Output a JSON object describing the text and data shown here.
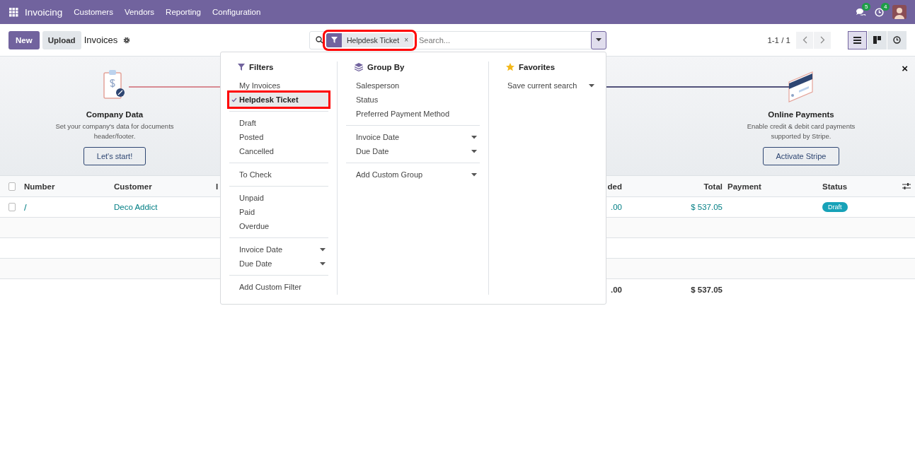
{
  "navbar": {
    "app": "Invoicing",
    "menus": [
      "Customers",
      "Vendors",
      "Reporting",
      "Configuration"
    ],
    "messages_badge": "5",
    "activities_badge": "4"
  },
  "control_panel": {
    "new_button": "New",
    "upload_button": "Upload",
    "title": "Invoices",
    "facet": {
      "label": "Helpdesk Ticket",
      "remove": "×",
      "highlighted": true
    },
    "search_placeholder": "Search...",
    "pager": "1-1 / 1",
    "views": [
      {
        "kind": "list",
        "selected": true
      },
      {
        "kind": "kanban",
        "selected": false
      },
      {
        "kind": "activity",
        "selected": false
      }
    ]
  },
  "onboarding": {
    "close": "×",
    "steps": [
      {
        "kind": "company",
        "title": "Company Data",
        "description": "Set your company's data for documents header/footer.",
        "button": "Let's start!"
      },
      {
        "kind": "payments",
        "title": "Online Payments",
        "description": "Enable credit & debit card payments supported by Stripe.",
        "button": "Activate Stripe"
      }
    ]
  },
  "table": {
    "all_selected": false,
    "columns": [
      "Number",
      "Customer",
      "I",
      "ded",
      "Total",
      "Payment",
      "Status"
    ],
    "rows": [
      {
        "number": "/",
        "customer": "Deco Addict",
        "column_4": ".00",
        "total": "$ 537.05",
        "status": "Draft",
        "selected": false
      }
    ],
    "totals": {
      "column_4": ".00",
      "total": "$ 537.05"
    }
  },
  "search_panel": {
    "filters": {
      "title": "Filters",
      "groups": [
        [
          {
            "label": "My Invoices",
            "kind": "option",
            "selected": false,
            "highlighted": false
          },
          {
            "label": "Helpdesk Ticket",
            "kind": "option",
            "selected": true,
            "highlighted": true
          }
        ],
        [
          {
            "label": "Draft",
            "kind": "option",
            "selected": false,
            "highlighted": false
          },
          {
            "label": "Posted",
            "kind": "option",
            "selected": false,
            "highlighted": false
          },
          {
            "label": "Cancelled",
            "kind": "option",
            "selected": false,
            "highlighted": false
          }
        ],
        [
          {
            "label": "To Check",
            "kind": "option",
            "selected": false,
            "highlighted": false
          }
        ],
        [
          {
            "label": "Unpaid",
            "kind": "option",
            "selected": false,
            "highlighted": false
          },
          {
            "label": "Paid",
            "kind": "option",
            "selected": false,
            "highlighted": false
          },
          {
            "label": "Overdue",
            "kind": "option",
            "selected": false,
            "highlighted": false
          }
        ],
        [
          {
            "label": "Invoice Date",
            "kind": "submenu",
            "selected": false,
            "highlighted": false
          },
          {
            "label": "Due Date",
            "kind": "submenu",
            "selected": false,
            "highlighted": false
          }
        ],
        [
          {
            "label": "Add Custom Filter",
            "kind": "option",
            "selected": false,
            "highlighted": false
          }
        ]
      ]
    },
    "group_by": {
      "title": "Group By",
      "groups": [
        [
          {
            "label": "Salesperson",
            "kind": "option",
            "selected": false,
            "highlighted": false
          },
          {
            "label": "Status",
            "kind": "option",
            "selected": false,
            "highlighted": false
          },
          {
            "label": "Preferred Payment Method",
            "kind": "option",
            "selected": false,
            "highlighted": false
          }
        ],
        [
          {
            "label": "Invoice Date",
            "kind": "submenu",
            "selected": false,
            "highlighted": false
          },
          {
            "label": "Due Date",
            "kind": "submenu",
            "selected": false,
            "highlighted": false
          }
        ],
        [
          {
            "label": "Add Custom Group",
            "kind": "submenu",
            "selected": false,
            "highlighted": false
          }
        ]
      ]
    },
    "favorites": {
      "title": "Favorites",
      "groups": [
        [
          {
            "label": "Save current search",
            "kind": "submenu",
            "selected": false,
            "highlighted": false
          }
        ]
      ]
    }
  }
}
